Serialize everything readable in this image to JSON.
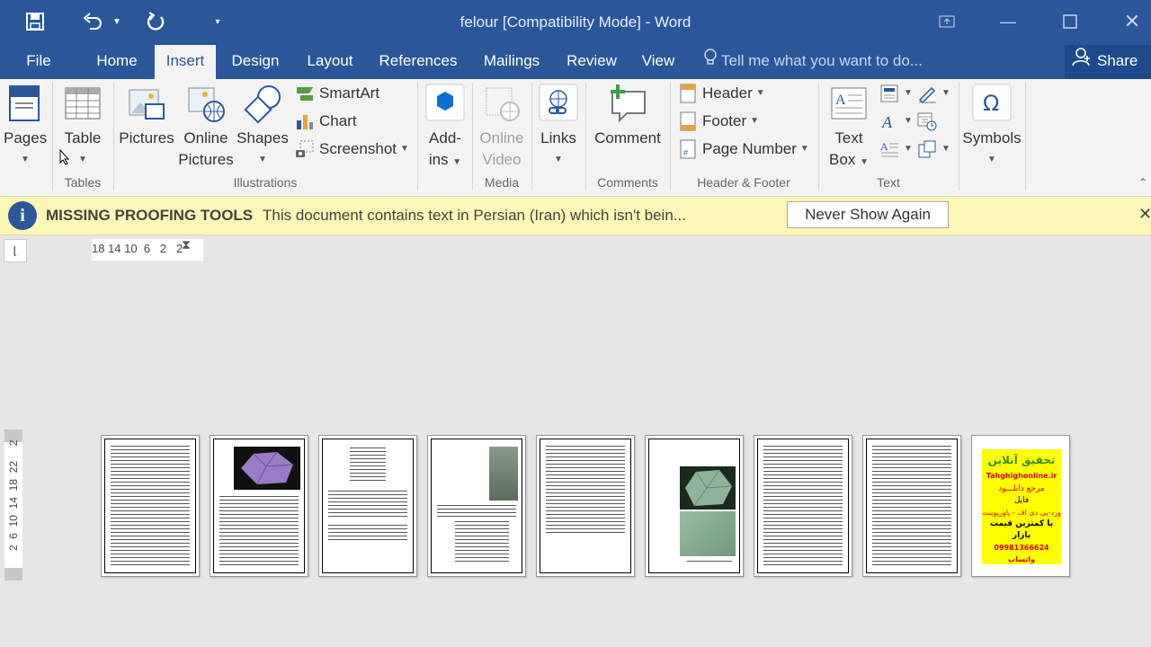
{
  "window": {
    "title": "felour [Compatibility Mode] - Word"
  },
  "tabs": [
    {
      "label": "File"
    },
    {
      "label": "Home"
    },
    {
      "label": "Insert",
      "active": true
    },
    {
      "label": "Design"
    },
    {
      "label": "Layout"
    },
    {
      "label": "References"
    },
    {
      "label": "Mailings"
    },
    {
      "label": "Review"
    },
    {
      "label": "View"
    }
  ],
  "tell_me": "Tell me what you want to do...",
  "share": "Share",
  "ribbon": {
    "pages": "Pages",
    "table": "Table",
    "pictures": "Pictures",
    "online_pictures_1": "Online",
    "online_pictures_2": "Pictures",
    "shapes": "Shapes",
    "smartart": "SmartArt",
    "chart": "Chart",
    "screenshot": "Screenshot",
    "addins_1": "Add-",
    "addins_2": "ins",
    "online_video_1": "Online",
    "online_video_2": "Video",
    "links": "Links",
    "comment": "Comment",
    "header": "Header",
    "footer": "Footer",
    "page_number": "Page Number",
    "text_box_1": "Text",
    "text_box_2": "Box",
    "symbols": "Symbols",
    "groups": {
      "tables": "Tables",
      "illustrations": "Illustrations",
      "media": "Media",
      "comments": "Comments",
      "header_footer": "Header & Footer",
      "text": "Text"
    }
  },
  "infobar": {
    "title": "MISSING PROOFING TOOLS",
    "message": "This document contains text in Persian (Iran) which isn't bein...",
    "button": "Never Show Again"
  },
  "ruler": {
    "horizontal": "18 14 10  6   2   2",
    "vertical_top": "2",
    "vertical": "2  6  10  14  18  22"
  },
  "ad_page": {
    "line1": "تحقیق آنلاین",
    "line2": "Tahghighonline.ir",
    "line3": "مرجع دانلـــود",
    "line4": "فایل",
    "line5": "ورد-پی دی اف - پاورپوینت",
    "line6": "با کمترین قیمت بازار",
    "line7": "09981366624 واتساپ"
  },
  "colors": {
    "brand": "#2b579a",
    "infobar_bg": "#fcf7b6",
    "ad_yellow": "#ffff00"
  }
}
